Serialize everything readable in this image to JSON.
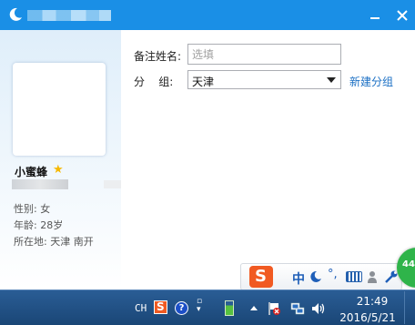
{
  "window": {
    "controls": {
      "minimize_icon": "minimize-icon",
      "close_icon": "close-icon"
    }
  },
  "profile": {
    "nickname": "小蜜蜂",
    "gender_line": "性别: 女",
    "age_line": "年龄: 28岁",
    "location_line": "所在地: 天津  南开"
  },
  "form": {
    "remark_label": "备注姓名:",
    "remark_placeholder": "选填",
    "remark_value": "",
    "group_label": "分    组:",
    "group_value": "天津",
    "new_group_link": "新建分组"
  },
  "ime": {
    "logo": "S",
    "mode": "中",
    "punct": "°,",
    "badge": "44"
  },
  "taskbar": {
    "lang": "CH",
    "help": "?",
    "time": "21:49",
    "date": "2016/5/21"
  },
  "colors": {
    "titlebar": "#1a8fe6",
    "link": "#1a6fc4",
    "ime_logo": "#f15a22",
    "taskbar": "#1d4f86"
  }
}
